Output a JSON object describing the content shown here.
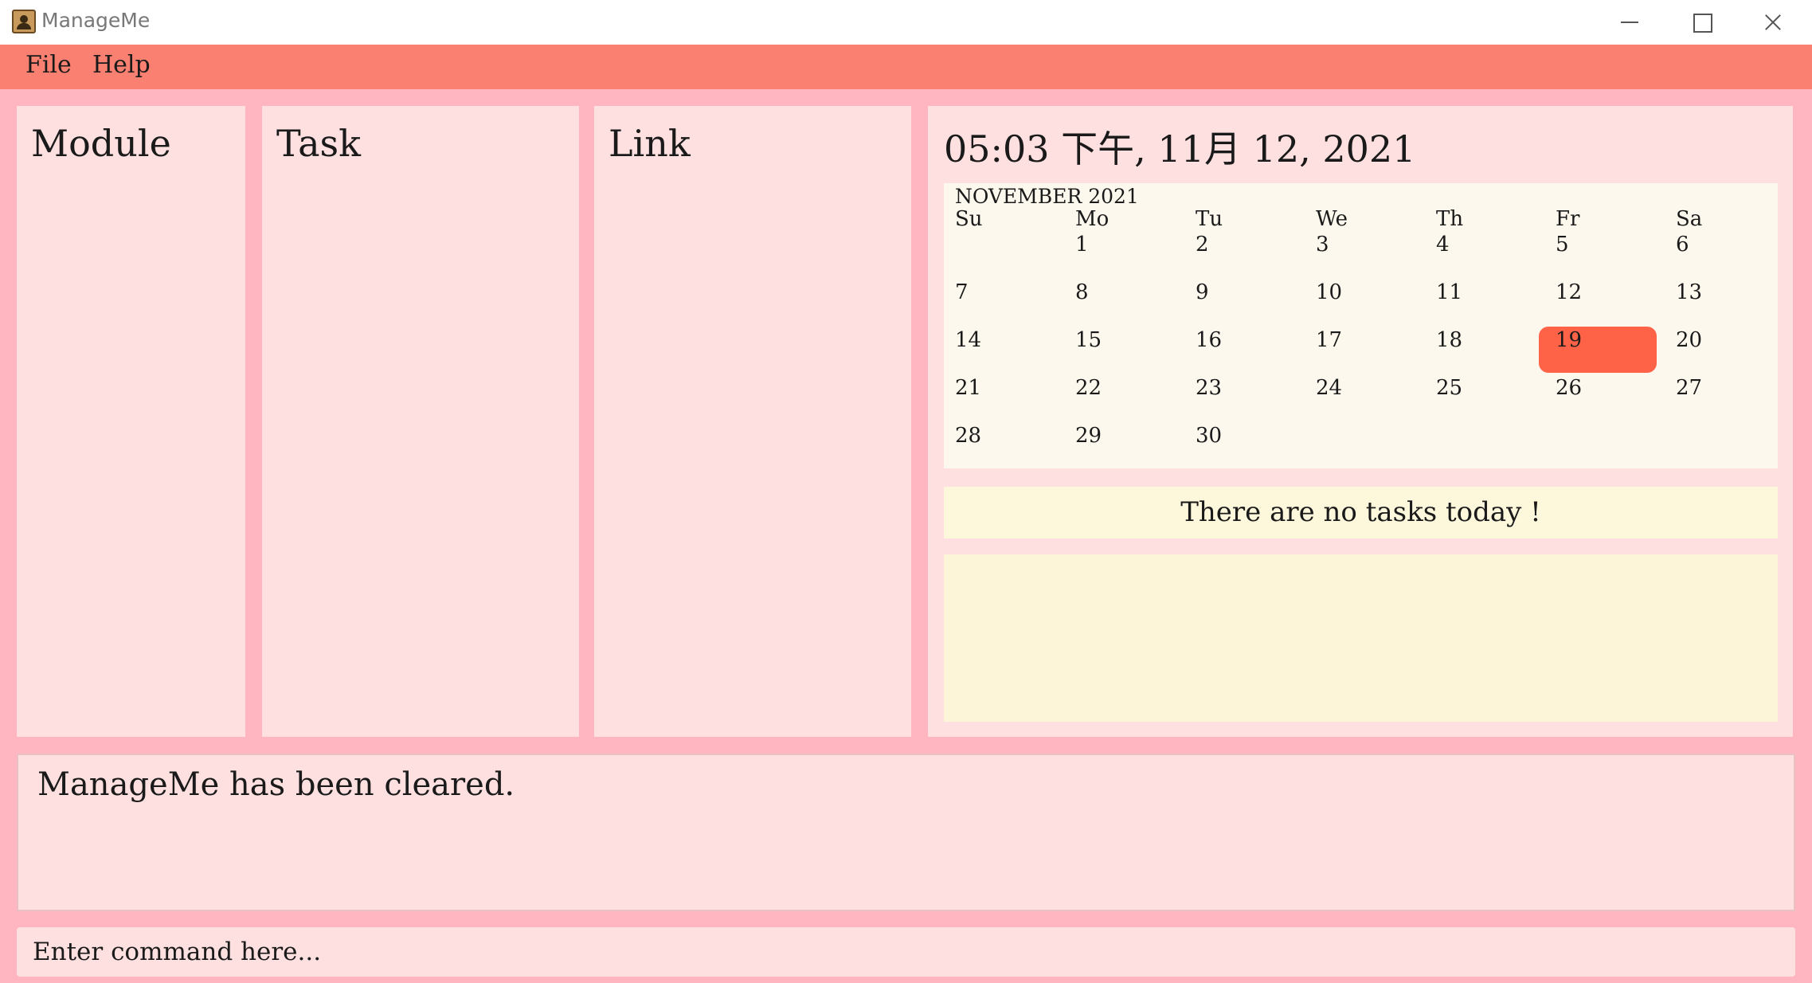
{
  "window": {
    "title": "ManageMe",
    "icon": "app-icon"
  },
  "menu": {
    "file": "File",
    "help": "Help"
  },
  "panels": {
    "module": "Module",
    "task": "Task",
    "link": "Link"
  },
  "datetime": "05:03 下午, 11月 12, 2021",
  "calendar": {
    "month_label": "NOVEMBER 2021",
    "day_headers": [
      "Su",
      "Mo",
      "Tu",
      "We",
      "Th",
      "Fr",
      "Sa"
    ],
    "weeks": [
      [
        "",
        "1",
        "2",
        "3",
        "4",
        "5",
        "6"
      ],
      [
        "7",
        "8",
        "9",
        "10",
        "11",
        "12",
        "13"
      ],
      [
        "14",
        "15",
        "16",
        "17",
        "18",
        "19",
        "20"
      ],
      [
        "21",
        "22",
        "23",
        "24",
        "25",
        "26",
        "27"
      ],
      [
        "28",
        "29",
        "30",
        "",
        "",
        "",
        ""
      ]
    ],
    "highlighted_day": "19",
    "highlight_color": "#ff6347"
  },
  "tasks_message": "There are no tasks today !",
  "result_message": "ManageMe has been cleared.",
  "command": {
    "placeholder": "Enter command here...",
    "value": ""
  },
  "colors": {
    "menu_bar": "#fa8072",
    "background": "#ffb6c1",
    "panel": "#ffe0e0",
    "calendar": "#fdf8ee"
  }
}
